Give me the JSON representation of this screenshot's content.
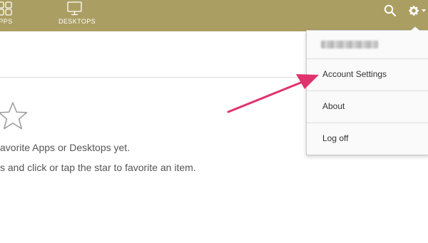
{
  "nav": {
    "apps_label": "APPS",
    "desktops_label": "DESKTOPS"
  },
  "toolbar": {
    "search_icon": "search-icon",
    "settings_icon": "gear-icon"
  },
  "empty_state": {
    "line1": "avorite Apps or Desktops yet.",
    "line2": "s and click or tap the star to favorite an item."
  },
  "menu": {
    "user_name": "",
    "items": [
      {
        "label": "Account Settings"
      },
      {
        "label": "About"
      },
      {
        "label": "Log off"
      }
    ]
  },
  "colors": {
    "topbar": "#ab9e62",
    "arrow": "#e0336e"
  }
}
